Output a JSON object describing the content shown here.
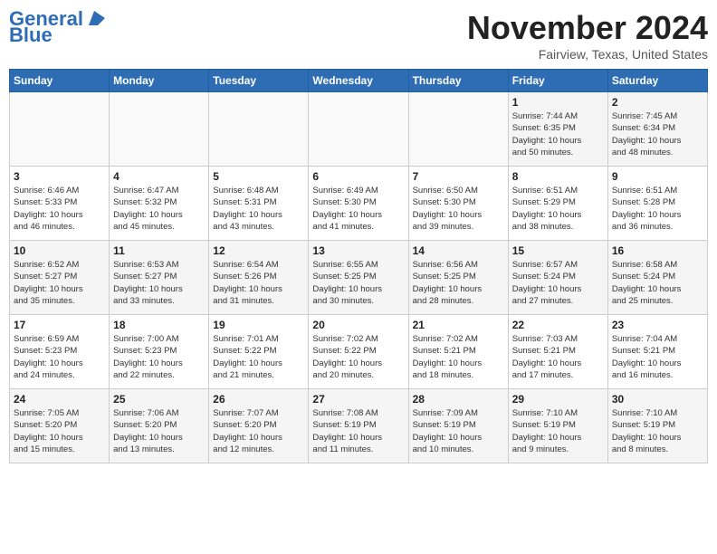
{
  "header": {
    "logo_line1": "General",
    "logo_line2": "Blue",
    "month": "November 2024",
    "location": "Fairview, Texas, United States"
  },
  "weekdays": [
    "Sunday",
    "Monday",
    "Tuesday",
    "Wednesday",
    "Thursday",
    "Friday",
    "Saturday"
  ],
  "weeks": [
    [
      {
        "day": "",
        "info": ""
      },
      {
        "day": "",
        "info": ""
      },
      {
        "day": "",
        "info": ""
      },
      {
        "day": "",
        "info": ""
      },
      {
        "day": "",
        "info": ""
      },
      {
        "day": "1",
        "info": "Sunrise: 7:44 AM\nSunset: 6:35 PM\nDaylight: 10 hours\nand 50 minutes."
      },
      {
        "day": "2",
        "info": "Sunrise: 7:45 AM\nSunset: 6:34 PM\nDaylight: 10 hours\nand 48 minutes."
      }
    ],
    [
      {
        "day": "3",
        "info": "Sunrise: 6:46 AM\nSunset: 5:33 PM\nDaylight: 10 hours\nand 46 minutes."
      },
      {
        "day": "4",
        "info": "Sunrise: 6:47 AM\nSunset: 5:32 PM\nDaylight: 10 hours\nand 45 minutes."
      },
      {
        "day": "5",
        "info": "Sunrise: 6:48 AM\nSunset: 5:31 PM\nDaylight: 10 hours\nand 43 minutes."
      },
      {
        "day": "6",
        "info": "Sunrise: 6:49 AM\nSunset: 5:30 PM\nDaylight: 10 hours\nand 41 minutes."
      },
      {
        "day": "7",
        "info": "Sunrise: 6:50 AM\nSunset: 5:30 PM\nDaylight: 10 hours\nand 39 minutes."
      },
      {
        "day": "8",
        "info": "Sunrise: 6:51 AM\nSunset: 5:29 PM\nDaylight: 10 hours\nand 38 minutes."
      },
      {
        "day": "9",
        "info": "Sunrise: 6:51 AM\nSunset: 5:28 PM\nDaylight: 10 hours\nand 36 minutes."
      }
    ],
    [
      {
        "day": "10",
        "info": "Sunrise: 6:52 AM\nSunset: 5:27 PM\nDaylight: 10 hours\nand 35 minutes."
      },
      {
        "day": "11",
        "info": "Sunrise: 6:53 AM\nSunset: 5:27 PM\nDaylight: 10 hours\nand 33 minutes."
      },
      {
        "day": "12",
        "info": "Sunrise: 6:54 AM\nSunset: 5:26 PM\nDaylight: 10 hours\nand 31 minutes."
      },
      {
        "day": "13",
        "info": "Sunrise: 6:55 AM\nSunset: 5:25 PM\nDaylight: 10 hours\nand 30 minutes."
      },
      {
        "day": "14",
        "info": "Sunrise: 6:56 AM\nSunset: 5:25 PM\nDaylight: 10 hours\nand 28 minutes."
      },
      {
        "day": "15",
        "info": "Sunrise: 6:57 AM\nSunset: 5:24 PM\nDaylight: 10 hours\nand 27 minutes."
      },
      {
        "day": "16",
        "info": "Sunrise: 6:58 AM\nSunset: 5:24 PM\nDaylight: 10 hours\nand 25 minutes."
      }
    ],
    [
      {
        "day": "17",
        "info": "Sunrise: 6:59 AM\nSunset: 5:23 PM\nDaylight: 10 hours\nand 24 minutes."
      },
      {
        "day": "18",
        "info": "Sunrise: 7:00 AM\nSunset: 5:23 PM\nDaylight: 10 hours\nand 22 minutes."
      },
      {
        "day": "19",
        "info": "Sunrise: 7:01 AM\nSunset: 5:22 PM\nDaylight: 10 hours\nand 21 minutes."
      },
      {
        "day": "20",
        "info": "Sunrise: 7:02 AM\nSunset: 5:22 PM\nDaylight: 10 hours\nand 20 minutes."
      },
      {
        "day": "21",
        "info": "Sunrise: 7:02 AM\nSunset: 5:21 PM\nDaylight: 10 hours\nand 18 minutes."
      },
      {
        "day": "22",
        "info": "Sunrise: 7:03 AM\nSunset: 5:21 PM\nDaylight: 10 hours\nand 17 minutes."
      },
      {
        "day": "23",
        "info": "Sunrise: 7:04 AM\nSunset: 5:21 PM\nDaylight: 10 hours\nand 16 minutes."
      }
    ],
    [
      {
        "day": "24",
        "info": "Sunrise: 7:05 AM\nSunset: 5:20 PM\nDaylight: 10 hours\nand 15 minutes."
      },
      {
        "day": "25",
        "info": "Sunrise: 7:06 AM\nSunset: 5:20 PM\nDaylight: 10 hours\nand 13 minutes."
      },
      {
        "day": "26",
        "info": "Sunrise: 7:07 AM\nSunset: 5:20 PM\nDaylight: 10 hours\nand 12 minutes."
      },
      {
        "day": "27",
        "info": "Sunrise: 7:08 AM\nSunset: 5:19 PM\nDaylight: 10 hours\nand 11 minutes."
      },
      {
        "day": "28",
        "info": "Sunrise: 7:09 AM\nSunset: 5:19 PM\nDaylight: 10 hours\nand 10 minutes."
      },
      {
        "day": "29",
        "info": "Sunrise: 7:10 AM\nSunset: 5:19 PM\nDaylight: 10 hours\nand 9 minutes."
      },
      {
        "day": "30",
        "info": "Sunrise: 7:10 AM\nSunset: 5:19 PM\nDaylight: 10 hours\nand 8 minutes."
      }
    ]
  ]
}
